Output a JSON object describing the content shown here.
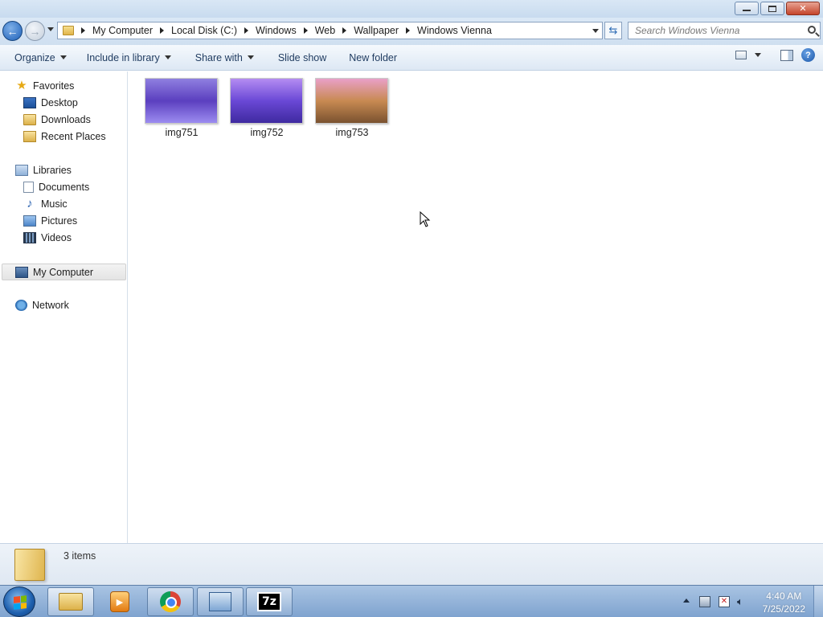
{
  "window": {
    "minimize_label": "minimize",
    "maximize_label": "restore",
    "close_label": "close"
  },
  "nav": {
    "breadcrumbs": [
      "My Computer",
      "Local Disk (C:)",
      "Windows",
      "Web",
      "Wallpaper",
      "Windows Vienna"
    ],
    "search_placeholder": "Search Windows Vienna"
  },
  "toolbar": {
    "organize": "Organize",
    "include_in_library": "Include in library",
    "share_with": "Share with",
    "slide_show": "Slide show",
    "new_folder": "New folder",
    "help": "?"
  },
  "sidebar": {
    "favorites": {
      "label": "Favorites",
      "items": [
        "Desktop",
        "Downloads",
        "Recent Places"
      ]
    },
    "libraries": {
      "label": "Libraries",
      "items": [
        "Documents",
        "Music",
        "Pictures",
        "Videos"
      ]
    },
    "computer": "My Computer",
    "network": "Network"
  },
  "files": [
    {
      "name": "img751",
      "colors": [
        "#8f7fe0",
        "#5b3fbf",
        "#9c8cf0"
      ]
    },
    {
      "name": "img752",
      "colors": [
        "#b48cf2",
        "#6a48d6",
        "#3f2aa0"
      ]
    },
    {
      "name": "img753",
      "colors": [
        "#e9a0c8",
        "#c88a52",
        "#7a5230"
      ]
    }
  ],
  "status": {
    "count": "3 items"
  },
  "taskbar": {
    "sevenzip_label": "7z",
    "time": "4:40 AM",
    "date": "7/25/2022"
  }
}
